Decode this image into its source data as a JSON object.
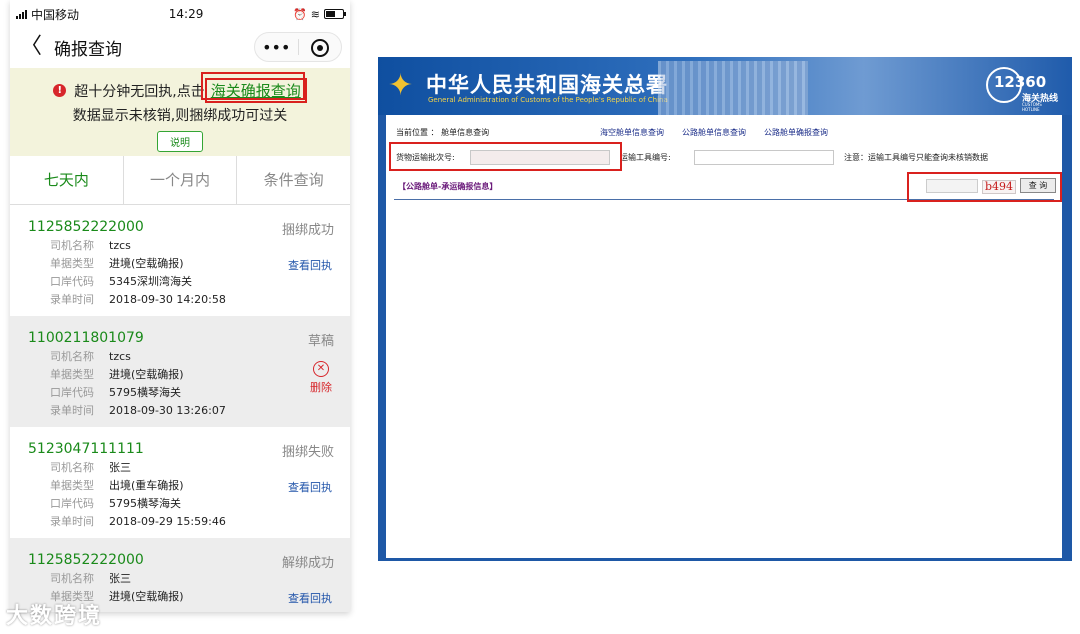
{
  "phone": {
    "status": {
      "carrier": "中国移动",
      "time": "14:29"
    },
    "nav": {
      "back": "〈",
      "title": "确报查询",
      "more": "•••"
    },
    "notice": {
      "alert_icon": "!",
      "text_prefix": "超十分钟无回执,点击",
      "link": "海关确报查询",
      "line2": "数据显示未核销,则捆绑成功可过关",
      "button": "说明"
    },
    "tabs": [
      {
        "label": "七天内",
        "active": true
      },
      {
        "label": "一个月内",
        "active": false
      },
      {
        "label": "条件查询",
        "active": false
      }
    ],
    "field_labels": {
      "driver": "司机名称",
      "doc_type": "单据类型",
      "port": "口岸代码",
      "time": "录单时间"
    },
    "records": [
      {
        "no": "1125852222000",
        "status": "捆绑成功",
        "driver": "tzcs",
        "doc_type": "进境(空载确报)",
        "port": "5345深圳湾海关",
        "time": "2018-09-30 14:20:58",
        "action": "查看回执"
      },
      {
        "no": "1100211801079",
        "status": "草稿",
        "driver": "tzcs",
        "doc_type": "进境(空载确报)",
        "port": "5795横琴海关",
        "time": "2018-09-30 13:26:07",
        "action": "删除"
      },
      {
        "no": "5123047111111",
        "status": "捆绑失败",
        "driver": "张三",
        "doc_type": "出境(重车确报)",
        "port": "5795横琴海关",
        "time": "2018-09-29 15:59:46",
        "action": "查看回执"
      },
      {
        "no": "1125852222000",
        "status": "解绑成功",
        "driver": "张三",
        "doc_type": "进境(空载确报)",
        "port": "",
        "time": "",
        "action": "查看回执"
      }
    ]
  },
  "watermark": "大数跨境",
  "web": {
    "banner": {
      "title_cn": "中华人民共和国海关总署",
      "title_en": "General Administration of Customs of the People's Republic of China",
      "hotline_num": "12360",
      "hotline_cn": "海关热线",
      "hotline_en": "CUSTOMS HOTLINE"
    },
    "breadcrumb": "当前位置 ： 舱单信息查询",
    "nav_links": [
      "海空舱单信息查询",
      "公路舱单信息查询",
      "公路舱单确报查询"
    ],
    "cargo_label": "货物运输批次号:",
    "vehicle_label": "运输工具编号:",
    "note": "注意：运输工具编号只能查询未核销数据",
    "section_title": "【公路舱单-承运确报信息】",
    "captcha": "b494",
    "query_button": "查 询"
  },
  "colors": {
    "green": "#1a8a1a",
    "highlight_red": "#d9211e",
    "customs_blue": "#1e58a6"
  }
}
